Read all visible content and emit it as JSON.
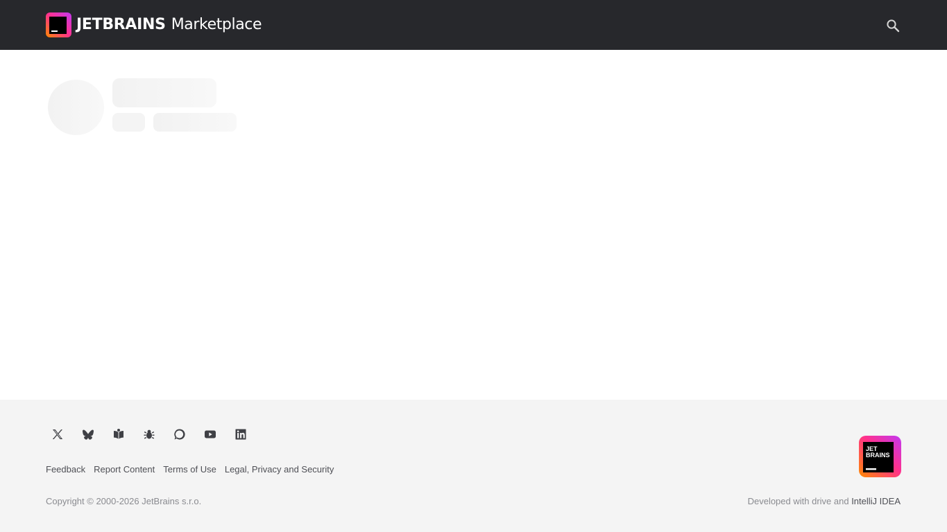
{
  "header": {
    "brand_name": "JETBRAINS",
    "product_name": "Marketplace",
    "search_icon": "search-icon"
  },
  "colors": {
    "header_bg": "#27282c",
    "footer_bg": "#f4f4f4",
    "skeleton": "#f4f4f4",
    "logo_gradient_start": "#ff318c",
    "logo_gradient_end": "#ff8a00"
  },
  "footer": {
    "social_icons": [
      "x-icon",
      "bluesky-icon",
      "blog-icon",
      "bug-icon",
      "chat-icon",
      "youtube-icon",
      "linkedin-icon"
    ],
    "links": [
      "Feedback",
      "Report Content",
      "Terms of Use",
      "Legal, Privacy and Security"
    ],
    "copyright": "Copyright © 2000-2026 JetBrains s.r.o.",
    "developed_prefix": "Developed with drive and ",
    "developed_link": "IntelliJ IDEA",
    "logo_text_line1": "JET",
    "logo_text_line2": "BRAINS"
  }
}
